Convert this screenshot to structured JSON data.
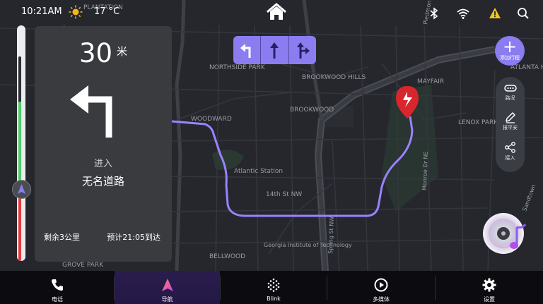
{
  "status_bar": {
    "time": "10:21AM",
    "temperature": "17 °C",
    "weather_icon": "sun-icon",
    "icons": [
      "bluetooth-icon",
      "wifi-icon",
      "warning-icon",
      "search-icon"
    ],
    "warning_color": "#f5c518"
  },
  "map": {
    "place_labels": [
      "PLANTATION",
      "NORTHSIDE PARK",
      "BROOKWOOD HILLS",
      "BROOKWOOD",
      "MAYFAIR",
      "WOODWARD",
      "LENOX PARK",
      "ATLANTA HILLS",
      "Atlantic Station",
      "14th St NW",
      "Georgia Institute of Technology",
      "BELLWOOD",
      "GROVE PARK",
      "Monroe Dr NE",
      "Spring St NW",
      "Sandtown",
      "Piedmont"
    ],
    "route_color": "#9b82ff",
    "destination_color": "#d8262e"
  },
  "lanes": [
    "left-arrow-icon",
    "straight-arrow-icon",
    "straight-right-arrow-icon"
  ],
  "add_trip": {
    "label": "添加行程",
    "icon": "plus-icon"
  },
  "side_tools": [
    {
      "label": "路况",
      "icon": "traffic-icon"
    },
    {
      "label": "报平安",
      "icon": "pencil-icon"
    },
    {
      "label": "接入",
      "icon": "share-icon"
    }
  ],
  "navigation": {
    "distance": "30",
    "distance_unit": "米",
    "turn_icon": "turn-left-arrow-icon",
    "action": "进入",
    "road": "无名道路",
    "remaining": "剩余3公里",
    "eta": "预计21:05到达"
  },
  "progress": {
    "fraction_remaining": 0.78
  },
  "dock": [
    {
      "label": "电话",
      "icon": "phone-icon",
      "active": false
    },
    {
      "label": "导航",
      "icon": "navigation-icon",
      "active": true
    },
    {
      "label": "Blink",
      "icon": "blink-icon",
      "active": false
    },
    {
      "label": "多媒体",
      "icon": "media-play-icon",
      "active": false
    },
    {
      "label": "设置",
      "icon": "gear-icon",
      "active": false
    }
  ],
  "colors": {
    "accent": "#8b7cf0",
    "card": "#3a3b3f",
    "dock": "#0c0c10"
  }
}
